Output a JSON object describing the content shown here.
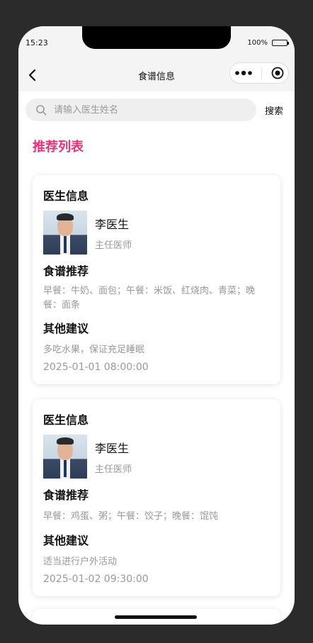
{
  "status": {
    "time": "15:23",
    "battery": "100%"
  },
  "nav": {
    "title": "食谱信息"
  },
  "search": {
    "placeholder": "请输入医生姓名",
    "button": "搜索"
  },
  "list_title": "推荐列表",
  "labels": {
    "doctor_info": "医生信息",
    "recipe": "食谱推荐",
    "advice": "其他建议"
  },
  "cards": [
    {
      "doctor_name": "李医生",
      "doctor_title": "主任医师",
      "recipe": "早餐：牛奶、面包；午餐：米饭、红烧肉、青菜；晚餐：面条",
      "advice": "多吃水果，保证充足睡眠",
      "date": "2025-01-01 08:00:00"
    },
    {
      "doctor_name": "李医生",
      "doctor_title": "主任医师",
      "recipe": "早餐：鸡蛋、粥；午餐：饺子；晚餐：馄饨",
      "advice": "适当进行户外活动",
      "date": "2025-01-02 09:30:00"
    }
  ]
}
